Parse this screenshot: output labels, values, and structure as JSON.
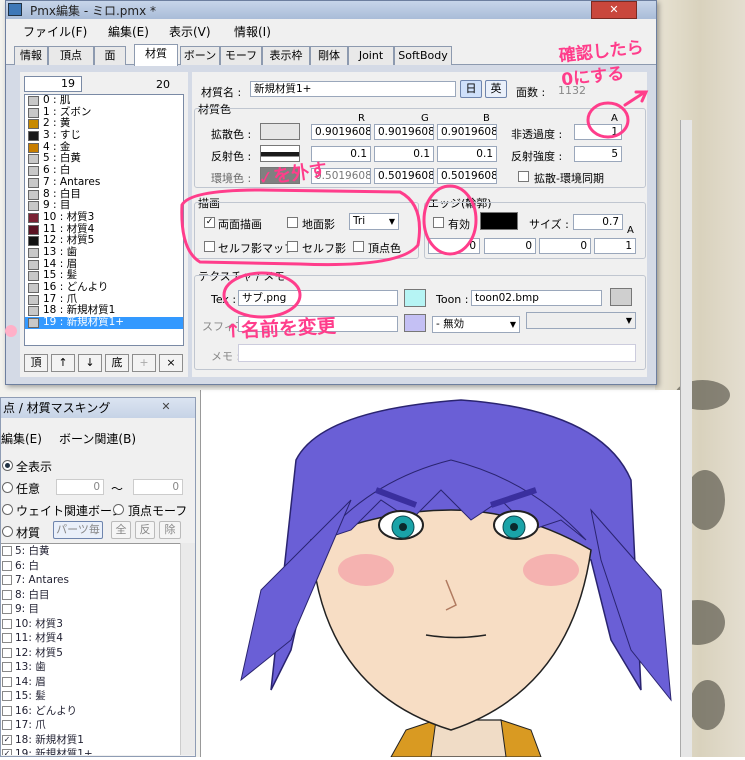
{
  "window": {
    "title": "Pmx編集 - ミロ.pmx *",
    "close_label": "✕"
  },
  "menu": [
    "ファイル(F)",
    "編集(E)",
    "表示(V)",
    "情報(I)"
  ],
  "tabs": [
    "情報",
    "頂点",
    "面",
    "材質",
    "ボーン",
    "モーフ",
    "表示枠",
    "剛体",
    "Joint",
    "SoftBody"
  ],
  "active_tab": "材質",
  "material_list": {
    "index_value": "19",
    "count": "20",
    "items": [
      {
        "label": "0 : 肌",
        "color": "#c8c8c8"
      },
      {
        "label": "1 : ズボン",
        "color": "#c8c8c8"
      },
      {
        "label": "2 : 黄",
        "color": "#c88a00"
      },
      {
        "label": "3 : すじ",
        "color": "#1a1a1a"
      },
      {
        "label": "4 : 金",
        "color": "#c87e00"
      },
      {
        "label": "5 : 白黄",
        "color": "#c8c8c8"
      },
      {
        "label": "6 : 白",
        "color": "#c8c8c8"
      },
      {
        "label": "7 : Antares",
        "color": "#c8c8c8"
      },
      {
        "label": "8 : 白目",
        "color": "#c8c8c8"
      },
      {
        "label": "9 : 目",
        "color": "#c8c8c8"
      },
      {
        "label": "10 : 材質3",
        "color": "#7a2233"
      },
      {
        "label": "11 : 材質4",
        "color": "#5a1222"
      },
      {
        "label": "12 : 材質5",
        "color": "#111111"
      },
      {
        "label": "13 : 歯",
        "color": "#c8c8c8"
      },
      {
        "label": "14 : 眉",
        "color": "#c8c8c8"
      },
      {
        "label": "15 : 髪",
        "color": "#c8c8c8"
      },
      {
        "label": "16 : どんより",
        "color": "#c8c8c8"
      },
      {
        "label": "17 : 爪",
        "color": "#c8c8c8"
      },
      {
        "label": "18 : 新規材質1",
        "color": "#c8c8c8"
      },
      {
        "label": "19 : 新規材質1+",
        "color": "#c8c8c8"
      }
    ],
    "selected_index": 19,
    "buttons": [
      "頂",
      "↑",
      "↓",
      "底",
      "+",
      "×"
    ]
  },
  "material": {
    "name_label": "材質名 :",
    "name_value": "新規材質1+",
    "lang_jp": "日",
    "lang_en": "英",
    "face_count_label": "面数 :",
    "face_count": "1132",
    "color_section": "材質色",
    "col_r": "R",
    "col_g": "G",
    "col_b": "B",
    "col_a": "A",
    "diffuse_label": "拡散色 :",
    "diffuse": [
      "0.9019608",
      "0.9019608",
      "0.9019608"
    ],
    "specular_label": "反射色 :",
    "specular": [
      "0.1",
      "0.1",
      "0.1"
    ],
    "ambient_label": "環境色 :",
    "ambient": [
      "0.5019608",
      "0.5019608",
      "0.5019608"
    ],
    "alpha_label": "非透過度 :",
    "alpha": "1",
    "spec_power_label": "反射強度 :",
    "spec_power": "5",
    "sync_label": "拡散-環境同期",
    "draw_section": "描画",
    "double_side": "両面描画",
    "ground_shadow": "地面影",
    "tri_value": "Tri",
    "self_shadow_map": "セルフ影マップ",
    "self_shadow": "セルフ影",
    "vertex_color": "頂点色",
    "edge_section": "エッジ(輪郭)",
    "edge_enable": "有効",
    "edge_size_label": "サイズ :",
    "edge_size": "0.7",
    "edge_color": [
      "0",
      "0",
      "0",
      "1"
    ],
    "texture_section": "テクスチャ / メモ",
    "tex_label": "Tex :",
    "tex_value": "サブ.png",
    "toon_label": "Toon :",
    "toon_value": "toon02.bmp",
    "sphere_label": "スフィア :",
    "sphere_mode": "- 無効",
    "memo_label": "メモ :"
  },
  "mask_window": {
    "title": "点 / 材質マスキング",
    "close_label": "✕",
    "menu": [
      "編集(E)",
      "ボーン関連(B)"
    ],
    "all_label": "全表示",
    "any_label": "任意",
    "range_from": "0",
    "range_sep": "〜",
    "range_to": "0",
    "weight_label": "ウェイト関連ボーン",
    "vertex_morph_label": "頂点モーフ",
    "material_label": "材質",
    "parts_btn": "パーツ毎",
    "all_btn": "全",
    "inv_btn": "反",
    "del_btn": "除",
    "items": [
      {
        "label": "5: 白黄",
        "checked": false
      },
      {
        "label": "6: 白",
        "checked": false
      },
      {
        "label": "7: Antares",
        "checked": false
      },
      {
        "label": "8: 白目",
        "checked": false
      },
      {
        "label": "9: 目",
        "checked": false
      },
      {
        "label": "10: 材質3",
        "checked": false
      },
      {
        "label": "11: 材質4",
        "checked": false
      },
      {
        "label": "12: 材質5",
        "checked": false
      },
      {
        "label": "13: 歯",
        "checked": false
      },
      {
        "label": "14: 眉",
        "checked": false
      },
      {
        "label": "15: 髪",
        "checked": false
      },
      {
        "label": "16: どんより",
        "checked": false
      },
      {
        "label": "17: 爪",
        "checked": false
      },
      {
        "label": "18: 新規材質1",
        "checked": true
      },
      {
        "label": "19: 新規材質1+",
        "checked": true
      }
    ]
  },
  "annotations": {
    "confirm": "確認したら\n0にする",
    "uncheck": "✓を外す",
    "rename": "↑名前を変更"
  },
  "colors": {
    "accent_pink": "#ff3d8b",
    "hair": "#6a5fd6",
    "skin": "#f7ddc4",
    "selection": "#3399ff"
  }
}
